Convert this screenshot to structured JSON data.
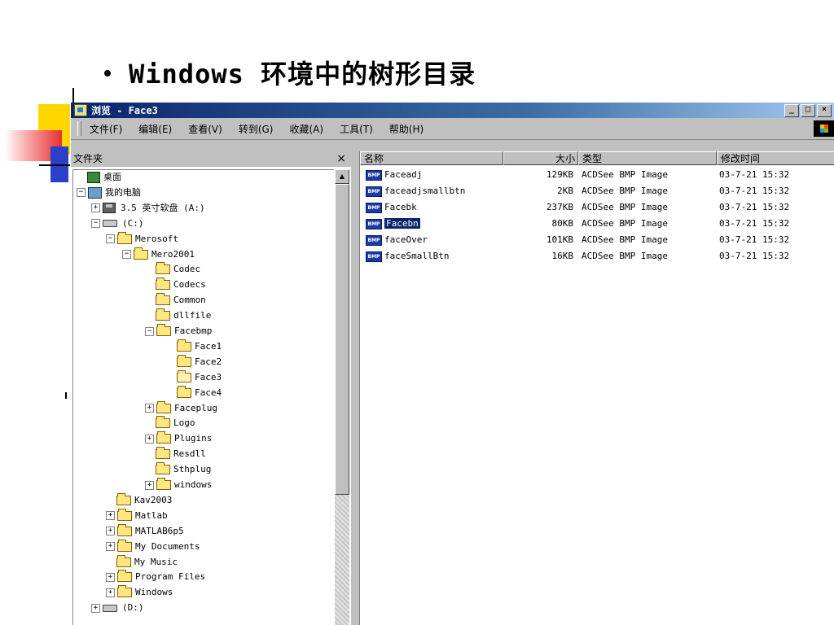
{
  "slide": {
    "title": "Windows 环境中的树形目录"
  },
  "window": {
    "title": "浏览 - Face3",
    "controls": [
      "_",
      "□",
      "×"
    ],
    "menu": [
      "文件(F)",
      "编辑(E)",
      "查看(V)",
      "转到(G)",
      "收藏(A)",
      "工具(T)",
      "帮助(H)"
    ]
  },
  "left_pane": {
    "header": "文件夹",
    "close": "×",
    "tree": [
      {
        "label": "桌面",
        "icon": "desktop-icon",
        "level": 0,
        "expander": ""
      },
      {
        "label": "我的电脑",
        "icon": "computer-icon",
        "level": 0,
        "expander": "−"
      },
      {
        "label": "3.5 英寸软盘 (A:)",
        "icon": "floppy-icon",
        "level": 1,
        "expander": "+"
      },
      {
        "label": "(C:)",
        "icon": "drive-icon",
        "level": 1,
        "expander": "−"
      },
      {
        "label": "Merosoft",
        "icon": "folder-icon",
        "level": 2,
        "expander": "−"
      },
      {
        "label": "Mero2001",
        "icon": "folder-icon",
        "level": 3,
        "expander": "−"
      },
      {
        "label": "Codec",
        "icon": "folder-icon",
        "level": 4,
        "expander": ""
      },
      {
        "label": "Codecs",
        "icon": "folder-icon",
        "level": 4,
        "expander": ""
      },
      {
        "label": "Common",
        "icon": "folder-icon",
        "level": 4,
        "expander": ""
      },
      {
        "label": "dllfile",
        "icon": "folder-icon",
        "level": 4,
        "expander": ""
      },
      {
        "label": "Facebmp",
        "icon": "folder-icon",
        "level": 4,
        "expander": "−"
      },
      {
        "label": "Face1",
        "icon": "folder-icon",
        "level": 5,
        "expander": ""
      },
      {
        "label": "Face2",
        "icon": "folder-icon",
        "level": 5,
        "expander": ""
      },
      {
        "label": "Face3",
        "icon": "folder-open-icon",
        "level": 5,
        "expander": ""
      },
      {
        "label": "Face4",
        "icon": "folder-icon",
        "level": 5,
        "expander": ""
      },
      {
        "label": "Faceplug",
        "icon": "folder-icon",
        "level": 4,
        "expander": "+"
      },
      {
        "label": "Logo",
        "icon": "folder-icon",
        "level": 4,
        "expander": ""
      },
      {
        "label": "Plugins",
        "icon": "folder-icon",
        "level": 4,
        "expander": "+"
      },
      {
        "label": "Resdll",
        "icon": "folder-icon",
        "level": 4,
        "expander": ""
      },
      {
        "label": "Sthplug",
        "icon": "folder-icon",
        "level": 4,
        "expander": ""
      },
      {
        "label": "windows",
        "icon": "folder-icon",
        "level": 4,
        "expander": "+"
      },
      {
        "label": "Kav2003",
        "icon": "folder-icon",
        "level": 2,
        "expander": ""
      },
      {
        "label": "Matlab",
        "icon": "folder-icon",
        "level": 2,
        "expander": "+"
      },
      {
        "label": "MATLAB6p5",
        "icon": "folder-icon",
        "level": 2,
        "expander": "+"
      },
      {
        "label": "My Documents",
        "icon": "folder-icon",
        "level": 2,
        "expander": "+"
      },
      {
        "label": "My Music",
        "icon": "folder-icon",
        "level": 2,
        "expander": ""
      },
      {
        "label": "Program Files",
        "icon": "folder-icon",
        "level": 2,
        "expander": "+"
      },
      {
        "label": "Windows",
        "icon": "folder-icon",
        "level": 2,
        "expander": "+"
      },
      {
        "label": "(D:)",
        "icon": "drive-icon",
        "level": 1,
        "expander": "+"
      }
    ]
  },
  "right_pane": {
    "columns": [
      "名称",
      "大小",
      "类型",
      "修改时间"
    ],
    "files": [
      {
        "name": "Faceadj",
        "size": "129KB",
        "type": "ACDSee BMP Image",
        "modified": "03-7-21 15:32",
        "selected": false
      },
      {
        "name": "faceadjsmallbtn",
        "size": "2KB",
        "type": "ACDSee BMP Image",
        "modified": "03-7-21 15:32",
        "selected": false
      },
      {
        "name": "Facebk",
        "size": "237KB",
        "type": "ACDSee BMP Image",
        "modified": "03-7-21 15:32",
        "selected": false
      },
      {
        "name": "Facebn",
        "size": "80KB",
        "type": "ACDSee BMP Image",
        "modified": "03-7-21 15:32",
        "selected": true
      },
      {
        "name": "faceOver",
        "size": "101KB",
        "type": "ACDSee BMP Image",
        "modified": "03-7-21 15:32",
        "selected": false
      },
      {
        "name": "faceSmallBtn",
        "size": "16KB",
        "type": "ACDSee BMP Image",
        "modified": "03-7-21 15:32",
        "selected": false
      }
    ],
    "file_icon_label": "BMP"
  }
}
